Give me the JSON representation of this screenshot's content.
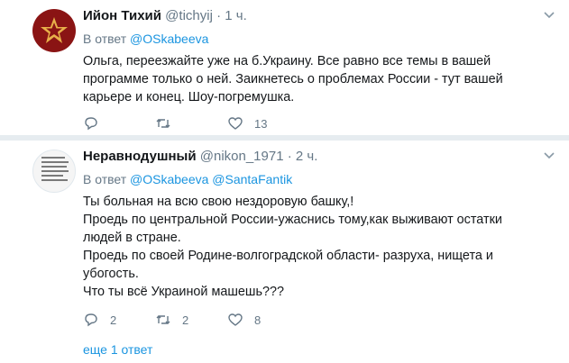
{
  "tweets": [
    {
      "name": "Ийон Тихий",
      "handle": "@tichyij",
      "time": "1 ч.",
      "reply_prefix": "В ответ",
      "reply_to": "@OSkabeeva",
      "text": "Ольга, переезжайте уже на б.Украину. Все равно все темы в вашей программе только о ней. Заикнетесь о проблемах России - тут вашей карьере и конец. Шоу-погремушка.",
      "replies": "",
      "retweets": "",
      "likes": "13",
      "avatar_icon": "red-star-icon"
    },
    {
      "name": "Неравнодушный",
      "handle": "@nikon_1971",
      "time": "2 ч.",
      "reply_prefix": "В ответ",
      "reply_to": "@OSkabeeva @SantaFantik",
      "lines": [
        "Ты больная на всю свою нездоровую башку,!",
        "Проедь по центральной России-ужаснись тому,как выживают остатки людей в стране.",
        "Проедь по своей Родине-волгоградской области- разруха, нищета и убогость.",
        "Что ты всё Украиной машешь???"
      ],
      "replies": "2",
      "retweets": "2",
      "likes": "8",
      "avatar_icon": "text-image-avatar"
    }
  ],
  "more_replies": "еще 1 ответ",
  "colors": {
    "link": "#1b95e0",
    "muted": "#657786",
    "separator": "#e6ecf0",
    "avatar1": "#8a1414",
    "star": "#e8b04a"
  }
}
